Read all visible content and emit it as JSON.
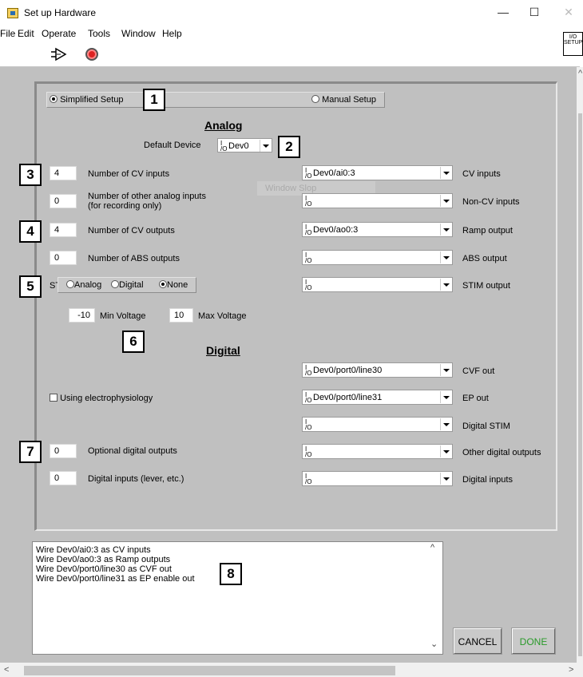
{
  "window": {
    "title": "Set up Hardware",
    "minimize": "—",
    "maximize": "☐",
    "close": "✕"
  },
  "menu": [
    "File",
    "Edit",
    "Operate",
    "Tools",
    "Window",
    "Help"
  ],
  "toolbar": {
    "run_icon": "run-arrow-icon",
    "stop_icon": "abort-stop-icon",
    "io_icon_text": "I/O SETUP"
  },
  "mode": {
    "simplified_label": "Simplified Setup",
    "manual_label": "Manual Setup",
    "selected": "Simplified Setup"
  },
  "badges": [
    "1",
    "2",
    "3",
    "4",
    "5",
    "6",
    "7",
    "8"
  ],
  "analog": {
    "heading": "Analog",
    "default_device_label": "Default Device",
    "default_device_value": "Dev0",
    "cv_inputs_count": "4",
    "cv_inputs_label": "Number of CV inputs",
    "other_inputs_count": "0",
    "other_inputs_label_1": "Number of other analog inputs",
    "other_inputs_label_2": "(for recording only)",
    "cv_outputs_count": "4",
    "cv_outputs_label": "Number of CV outputs",
    "abs_outputs_count": "0",
    "abs_outputs_label": "Number of ABS outputs",
    "stim_label": "STIM:",
    "stim_options": [
      "Analog",
      "Digital",
      "None"
    ],
    "stim_selected": "None",
    "min_voltage_value": "-10",
    "min_voltage_label": "Min Voltage",
    "max_voltage_value": "10",
    "max_voltage_label": "Max Voltage",
    "channels": [
      {
        "value": "Dev0/ai0:3",
        "label": "CV inputs"
      },
      {
        "value": "",
        "label": "Non-CV inputs"
      },
      {
        "value": "Dev0/ao0:3",
        "label": "Ramp output"
      },
      {
        "value": "",
        "label": "ABS output"
      },
      {
        "value": "",
        "label": "STIM output"
      }
    ],
    "watermark": "Window Slop"
  },
  "digital": {
    "heading": "Digital",
    "electrophysiology_label": "Using electrophysiology",
    "electrophysiology_checked": false,
    "optional_outputs_count": "0",
    "optional_outputs_label": "Optional digital outputs",
    "digital_inputs_count": "0",
    "digital_inputs_label": "Digital inputs (lever, etc.)",
    "channels": [
      {
        "value": "Dev0/port0/line30",
        "label": "CVF out"
      },
      {
        "value": "Dev0/port0/line31",
        "label": "EP out"
      },
      {
        "value": "",
        "label": "Digital STIM"
      },
      {
        "value": "",
        "label": "Other digital outputs"
      },
      {
        "value": "",
        "label": "Digital inputs"
      }
    ]
  },
  "log": {
    "lines": [
      "Wire Dev0/ai0:3 as CV inputs",
      "Wire Dev0/ao0:3 as Ramp outputs",
      "Wire Dev0/port0/line30 as CVF out",
      "Wire Dev0/port0/line31 as EP enable out"
    ]
  },
  "buttons": {
    "cancel": "CANCEL",
    "done": "DONE"
  },
  "colors": {
    "panel_bg": "#c0c0c0",
    "done_text": "#2a9a2a",
    "stop_red": "#dd2222"
  }
}
